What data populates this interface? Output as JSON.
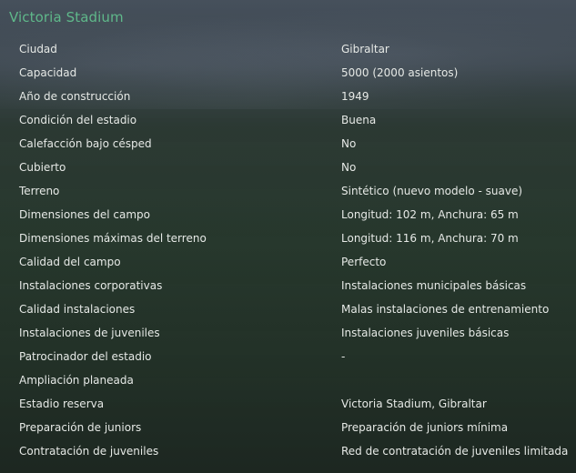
{
  "panel": {
    "title": "Victoria Stadium"
  },
  "rows": [
    {
      "label": "Ciudad",
      "value": "Gibraltar"
    },
    {
      "label": "Capacidad",
      "value": "5000 (2000 asientos)"
    },
    {
      "label": "Año de construcción",
      "value": "1949"
    },
    {
      "label": "Condición del estadio",
      "value": "Buena"
    },
    {
      "label": "Calefacción bajo césped",
      "value": "No"
    },
    {
      "label": "Cubierto",
      "value": "No"
    },
    {
      "label": "Terreno",
      "value": "Sintético (nuevo modelo - suave)"
    },
    {
      "label": "Dimensiones del campo",
      "value": "Longitud: 102 m, Anchura: 65 m"
    },
    {
      "label": "Dimensiones máximas del terreno",
      "value": "Longitud: 116 m, Anchura: 70 m"
    },
    {
      "label": "Calidad del campo",
      "value": "Perfecto"
    },
    {
      "label": "Instalaciones corporativas",
      "value": "Instalaciones municipales básicas"
    },
    {
      "label": "Calidad instalaciones",
      "value": "Malas instalaciones de entrenamiento"
    },
    {
      "label": "Instalaciones de juveniles",
      "value": "Instalaciones juveniles básicas"
    },
    {
      "label": "Patrocinador del estadio",
      "value": "-"
    },
    {
      "label": "Ampliación planeada",
      "value": ""
    },
    {
      "label": "Estadio reserva",
      "value": "Victoria Stadium, Gibraltar"
    },
    {
      "label": "Preparación de juniors",
      "value": "Preparación de juniors mínima"
    },
    {
      "label": "Contratación de juveniles",
      "value": "Red de contratación de juveniles limitada"
    }
  ],
  "colors": {
    "title": "#5fb88a",
    "text": "#e6e9e6"
  }
}
